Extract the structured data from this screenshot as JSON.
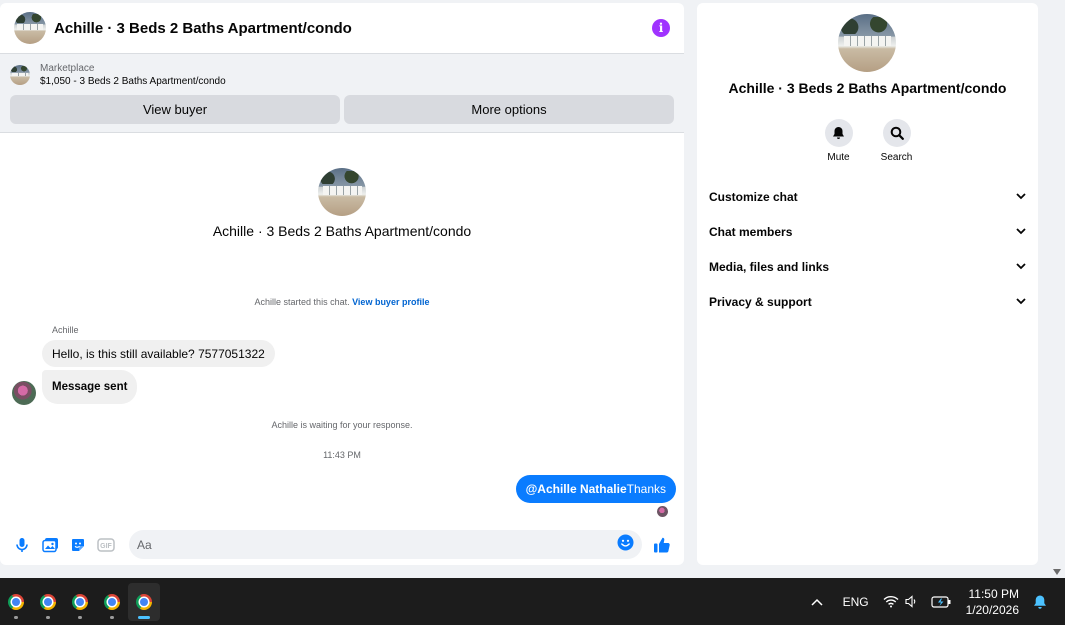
{
  "chat": {
    "header_title": "Achille · 3 Beds 2 Baths Apartment/condo",
    "info_icon": "i",
    "listing": {
      "caption": "Marketplace",
      "price_title": "$1,050 - 3 Beds 2 Baths Apartment/condo",
      "view_buyer_label": "View buyer",
      "more_options_label": "More options"
    },
    "thread": {
      "title": "Achille · 3 Beds 2 Baths Apartment/condo",
      "started_text": "Achille started this chat.",
      "view_profile_link": "View buyer profile",
      "sender_name": "Achille",
      "messages": [
        "Hello, is this still available? 7577051322",
        "Message sent"
      ],
      "waiting_text": "Achille is waiting for your response.",
      "timestamp": "11:43 PM",
      "my_message_mention": "@Achille Nathalie",
      "my_message_text": "Thanks"
    },
    "composer": {
      "placeholder": "Aa"
    }
  },
  "info_panel": {
    "title": "Achille · 3 Beds 2 Baths Apartment/condo",
    "mute_label": "Mute",
    "search_label": "Search",
    "sections": [
      "Customize chat",
      "Chat members",
      "Media, files and links",
      "Privacy & support"
    ]
  },
  "taskbar": {
    "language": "ENG",
    "time": "11:50 PM",
    "date": "1/20/2026"
  },
  "colors": {
    "messenger_blue": "#0a7cff",
    "info_purple": "#a033ff",
    "link_blue": "#0064d1"
  }
}
